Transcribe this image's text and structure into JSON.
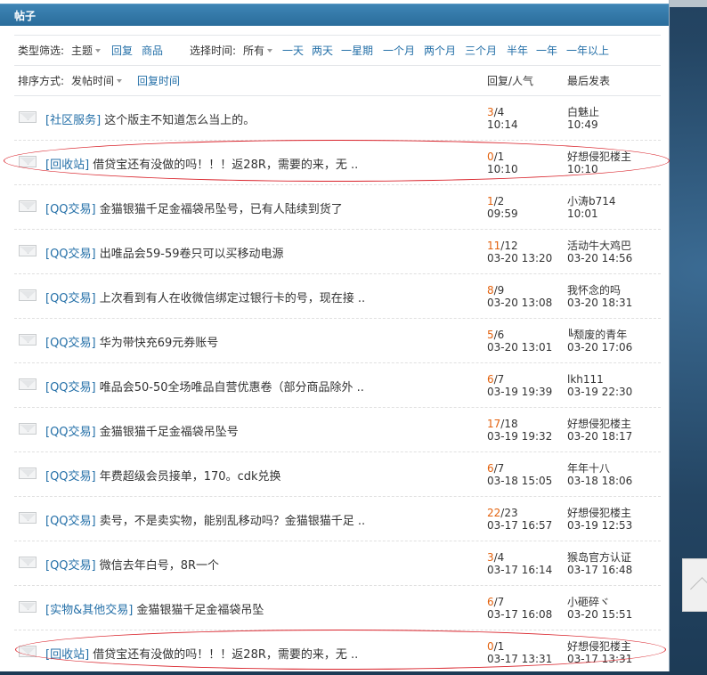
{
  "panel": {
    "title": "帖子"
  },
  "filter": {
    "type_label": "类型筛选:",
    "type_selected": "主题",
    "type_options": [
      "回复",
      "商品"
    ],
    "time_label": "选择时间:",
    "time_selected": "所有",
    "time_options": [
      "一天",
      "两天",
      "一星期",
      "一个月",
      "两个月",
      "三个月",
      "半年",
      "一年",
      "一年以上"
    ]
  },
  "sort": {
    "label": "排序方式:",
    "selected": "发帖时间",
    "alt": "回复时间"
  },
  "columns": {
    "reply": "回复/人气",
    "last": "最后发表"
  },
  "threads": [
    {
      "cat": "[社区服务]",
      "title": "这个版主不知道怎么当上的。",
      "replies": "3",
      "views": "/4",
      "time": "10:14",
      "last_user": "白魅止",
      "last_time": "10:49"
    },
    {
      "cat": "[回收站]",
      "title": "借贷宝还有没做的吗！！！返28R，需要的来，无 ..",
      "replies": "0",
      "views": "/1",
      "time": "10:10",
      "last_user": "好想侵犯楼主",
      "last_time": "10:10"
    },
    {
      "cat": "[QQ交易]",
      "title": "金猫银猫千足金福袋吊坠号，已有人陆续到货了",
      "replies": "1",
      "views": "/2",
      "time": "09:59",
      "last_user": "小涛b714",
      "last_time": "10:01"
    },
    {
      "cat": "[QQ交易]",
      "title": "出唯品会59-59卷只可以买移动电源",
      "replies": "11",
      "views": "/12",
      "time": "03-20 13:20",
      "last_user": "活动牛大鸡巴",
      "last_time": "03-20 14:56"
    },
    {
      "cat": "[QQ交易]",
      "title": "上次看到有人在收微信绑定过银行卡的号，现在接 ..",
      "replies": "8",
      "views": "/9",
      "time": "03-20 13:08",
      "last_user": "我怀念的吗",
      "last_time": "03-20 18:31"
    },
    {
      "cat": "[QQ交易]",
      "title": "华为带快充69元券账号",
      "replies": "5",
      "views": "/6",
      "time": "03-20 13:01",
      "last_user": "╚颓废的青年",
      "last_time": "03-20 17:06"
    },
    {
      "cat": "[QQ交易]",
      "title": "唯品会50-50全场唯品自营优惠卷（部分商品除外 ..",
      "replies": "6",
      "views": "/7",
      "time": "03-19 19:39",
      "last_user": "lkh111",
      "last_time": "03-19 22:30"
    },
    {
      "cat": "[QQ交易]",
      "title": "金猫银猫千足金福袋吊坠号",
      "replies": "17",
      "views": "/18",
      "time": "03-19 19:32",
      "last_user": "好想侵犯楼主",
      "last_time": "03-20 18:17"
    },
    {
      "cat": "[QQ交易]",
      "title": "年费超级会员接单，170。cdk兑换",
      "replies": "6",
      "views": "/7",
      "time": "03-18 15:05",
      "last_user": "年年十八",
      "last_time": "03-18 18:06"
    },
    {
      "cat": "[QQ交易]",
      "title": "卖号，不是卖实物，能别乱移动吗？金猫银猫千足 ..",
      "replies": "22",
      "views": "/23",
      "time": "03-17 16:57",
      "last_user": "好想侵犯楼主",
      "last_time": "03-19 12:53"
    },
    {
      "cat": "[QQ交易]",
      "title": "微信去年白号，8R一个",
      "replies": "3",
      "views": "/4",
      "time": "03-17 16:14",
      "last_user": "猴岛官方认证",
      "last_time": "03-17 16:48"
    },
    {
      "cat": "[实物&其他交易]",
      "title": "金猫银猫千足金福袋吊坠",
      "replies": "6",
      "views": "/7",
      "time": "03-17 16:08",
      "last_user": "小砸碎ヾ",
      "last_time": "03-20 15:51"
    },
    {
      "cat": "[回收站]",
      "title": "借贷宝还有没做的吗！！！返28R，需要的来，无 ..",
      "replies": "0",
      "views": "/1",
      "time": "03-17 13:31",
      "last_user": "好想侵犯楼主",
      "last_time": "03-17 13:31"
    }
  ]
}
